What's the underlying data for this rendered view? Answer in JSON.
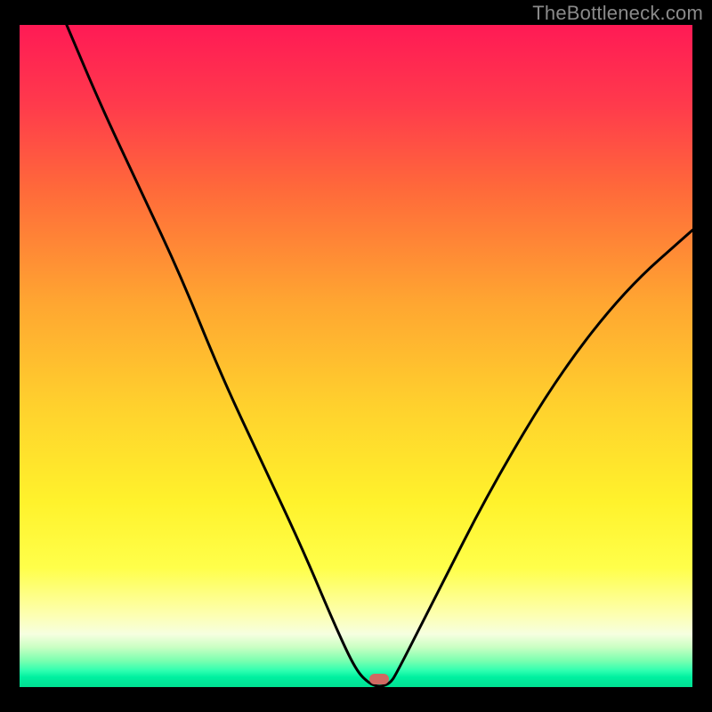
{
  "watermark": "TheBottleneck.com",
  "marker": {
    "color": "#cf6a62"
  },
  "chart_data": {
    "type": "line",
    "title": "",
    "xlabel": "",
    "ylabel": "",
    "xlim": [
      0,
      100
    ],
    "ylim": [
      0,
      100
    ],
    "series": [
      {
        "name": "bottleneck-curve",
        "x": [
          7,
          12,
          18,
          24,
          30,
          36,
          42,
          47,
          50,
          52,
          53.5,
          55,
          56,
          62,
          70,
          80,
          90,
          100
        ],
        "y": [
          100,
          88,
          75,
          62,
          47,
          34,
          21,
          9,
          2.5,
          0.5,
          0,
          0.5,
          2,
          14,
          30,
          47,
          60,
          69
        ]
      }
    ],
    "annotations": [
      {
        "name": "min-marker",
        "x": 53.5,
        "y": 1.2
      }
    ],
    "gradient_stops": [
      {
        "pct": 0,
        "color": "#ff1a55"
      },
      {
        "pct": 25,
        "color": "#ff6a3a"
      },
      {
        "pct": 58,
        "color": "#ffd22d"
      },
      {
        "pct": 82,
        "color": "#ffff4a"
      },
      {
        "pct": 92,
        "color": "#f6ffe0"
      },
      {
        "pct": 97,
        "color": "#2fffb0"
      },
      {
        "pct": 100,
        "color": "#00e092"
      }
    ]
  }
}
